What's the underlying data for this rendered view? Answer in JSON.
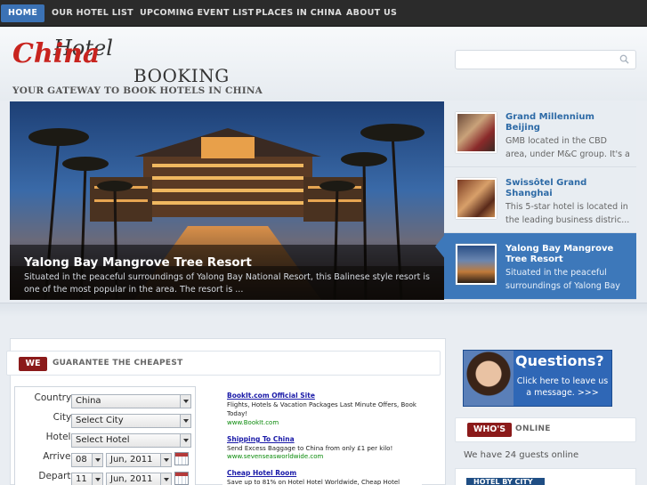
{
  "nav": {
    "items": [
      "HOME",
      "OUR HOTEL LIST",
      "UPCOMING EVENT LIST",
      "PLACES IN CHINA",
      "ABOUT US"
    ]
  },
  "logo": {
    "script_text": "China",
    "hotel_text": "Hotel",
    "booking_text": "BOOKING",
    "tagline": "YOUR GATEWAY TO BOOK HOTELS IN CHINA"
  },
  "search": {
    "placeholder": ""
  },
  "slider": {
    "title": "Yalong Bay Mangrove Tree Resort",
    "text": "Situated in the peaceful surroundings of Yalong Bay National Resort, this Balinese style resort is one of the most popular in the area. The resort is ..."
  },
  "side_items": [
    {
      "title": "Grand Millennium Beijing",
      "text": "GMB located in the CBD area, under M&C group. It's a pre..."
    },
    {
      "title": "Swissôtel Grand Shanghai",
      "text": "This 5-star hotel is located in the leading business distric..."
    },
    {
      "title": "Yalong Bay Mangrove Tree Resort",
      "text": "Situated in the peaceful surroundings of Yalong Bay National..."
    }
  ],
  "guarantee": {
    "tag": "WE",
    "rest": "GUARANTEE THE CHEAPEST"
  },
  "form": {
    "country_label": "Country:",
    "country_value": "China",
    "city_label": "City:",
    "city_value": "Select City",
    "hotel_label": "Hotel:",
    "hotel_value": "Select Hotel",
    "arrive_label": "Arrive:",
    "arrive_day": "08",
    "arrive_month": "Jun, 2011",
    "depart_label": "Depart:",
    "depart_day": "11",
    "depart_month": "Jun, 2011"
  },
  "ads": [
    {
      "title": "BookIt.com Official Site",
      "text": "Flights, Hotels & Vacation Packages Last Minute Offers, Book Today!",
      "url": "www.BookIt.com"
    },
    {
      "title": "Shipping To China",
      "text": "Send Excess Baggage to China from only £1 per kilo!",
      "url": "www.sevenseasworldwide.com"
    },
    {
      "title": "Cheap Hotel Room",
      "text": "Save up to 81% on Hotel Hotel Worldwide, Cheap Hotel",
      "url": ""
    }
  ],
  "banner": {
    "heading": "Questions?",
    "sub": "Click here to leave us a message. >>>"
  },
  "whos_online": {
    "tag": "WHO'S",
    "rest": "ONLINE",
    "text": "We have 24 guests online"
  },
  "hotel_by_city": {
    "label": "HOTEL BY CITY"
  }
}
